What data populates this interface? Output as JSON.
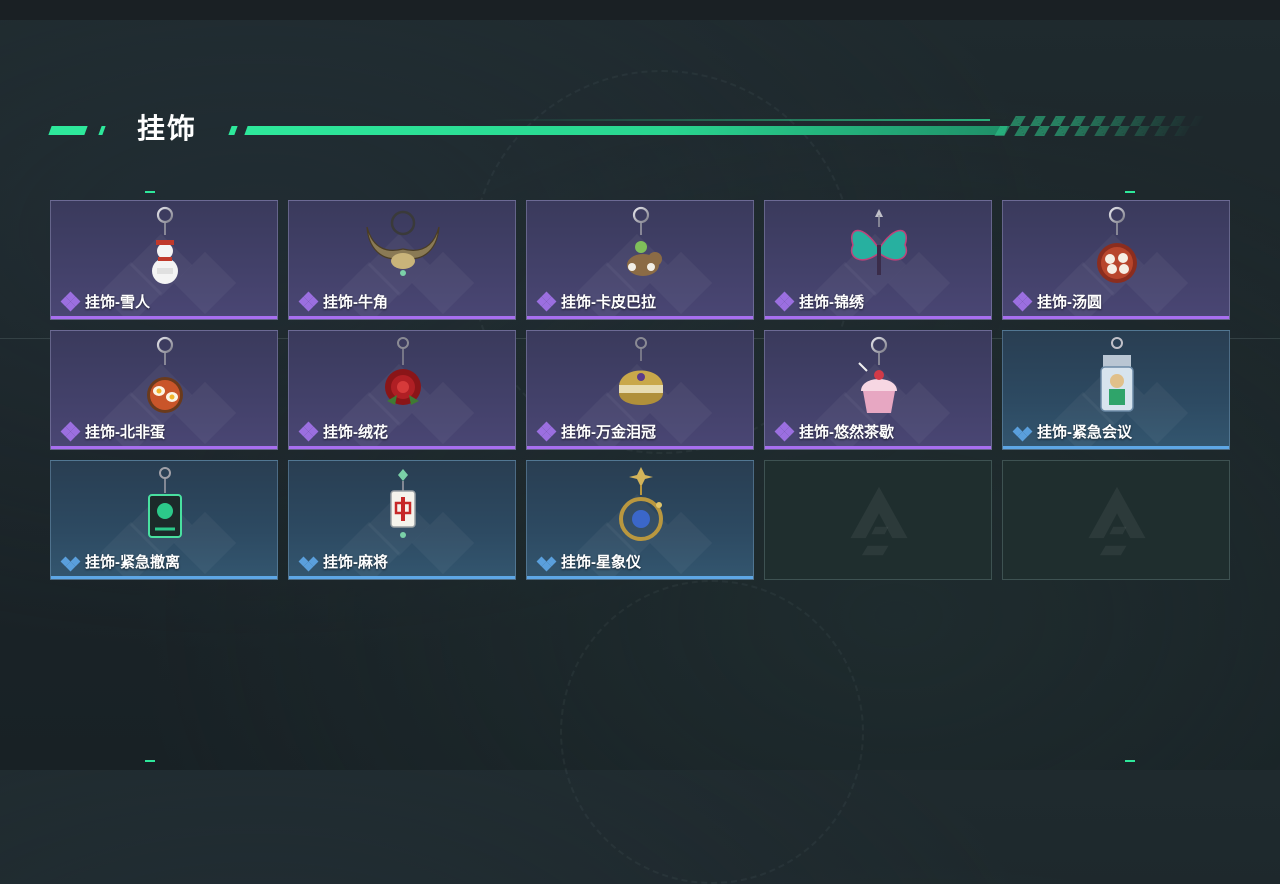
{
  "page": {
    "title": "挂饰"
  },
  "items": [
    {
      "name": "挂饰-雪人",
      "rarity": "purple",
      "icon": "snowman-charm-icon"
    },
    {
      "name": "挂饰-牛角",
      "rarity": "purple",
      "icon": "horn-charm-icon"
    },
    {
      "name": "挂饰-卡皮巴拉",
      "rarity": "purple",
      "icon": "capybara-charm-icon"
    },
    {
      "name": "挂饰-锦绣",
      "rarity": "purple",
      "icon": "butterfly-charm-icon"
    },
    {
      "name": "挂饰-汤圆",
      "rarity": "purple",
      "icon": "tangyuan-charm-icon"
    },
    {
      "name": "挂饰-北非蛋",
      "rarity": "purple",
      "icon": "shakshuka-charm-icon"
    },
    {
      "name": "挂饰-绒花",
      "rarity": "purple",
      "icon": "rose-charm-icon"
    },
    {
      "name": "挂饰-万金泪冠",
      "rarity": "purple",
      "icon": "crown-charm-icon"
    },
    {
      "name": "挂饰-悠然茶歇",
      "rarity": "purple",
      "icon": "cupcake-charm-icon"
    },
    {
      "name": "挂饰-紧急会议",
      "rarity": "blue",
      "icon": "meeting-charm-icon"
    },
    {
      "name": "挂饰-紧急撤离",
      "rarity": "blue",
      "icon": "evacuation-charm-icon"
    },
    {
      "name": "挂饰-麻将",
      "rarity": "blue",
      "icon": "mahjong-charm-icon"
    },
    {
      "name": "挂饰-星象仪",
      "rarity": "blue",
      "icon": "astrolabe-charm-icon"
    }
  ],
  "empty_slots": 2,
  "empty_slot_icon": "game-logo-icon",
  "colors": {
    "accent": "#2ee89b",
    "purple_rarity": "#a86ff0",
    "blue_rarity": "#5ea7e6"
  }
}
